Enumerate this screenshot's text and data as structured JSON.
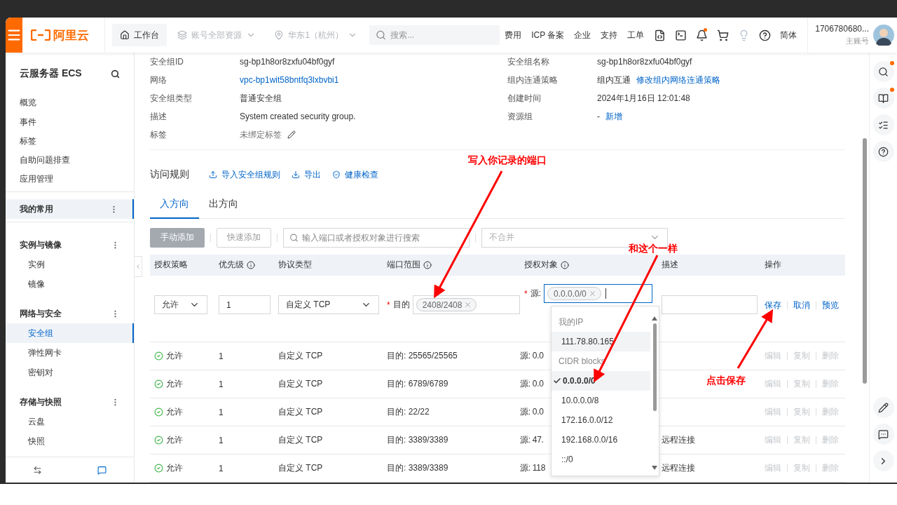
{
  "header": {
    "logo": "阿里云",
    "workbench": "工作台",
    "resources": "账号全部资源",
    "region": "华东1（杭州）",
    "search_placeholder": "搜索...",
    "links": [
      "费用",
      "ICP 备案",
      "企业",
      "支持",
      "工单"
    ],
    "icons": [
      {
        "kind": "api",
        "dot": false
      },
      {
        "kind": "terminal",
        "dot": false
      },
      {
        "kind": "bell",
        "dot": true
      },
      {
        "kind": "cart",
        "dot": false
      },
      {
        "kind": "bulb",
        "dot": false
      },
      {
        "kind": "help",
        "dot": false
      }
    ],
    "language": "简体",
    "account": {
      "id": "1706780680...",
      "role": "主账号"
    }
  },
  "sidebar": {
    "title": "云服务器 ECS",
    "items": [
      {
        "label": "概览",
        "selected": false
      },
      {
        "label": "事件",
        "selected": false
      },
      {
        "label": "标签",
        "selected": false
      },
      {
        "label": "自助问题排查",
        "selected": false
      },
      {
        "label": "应用管理",
        "selected": false
      }
    ],
    "groups": [
      {
        "label": "我的常用",
        "selected": true
      },
      {
        "label": "实例与镜像",
        "selected": false,
        "children": [
          {
            "label": "实例",
            "selected": false
          },
          {
            "label": "镜像",
            "selected": false
          }
        ]
      },
      {
        "label": "网络与安全",
        "selected": false,
        "children": [
          {
            "label": "安全组",
            "selected": true
          },
          {
            "label": "弹性网卡",
            "selected": false
          },
          {
            "label": "密钥对",
            "selected": false
          }
        ]
      },
      {
        "label": "存储与快照",
        "selected": false,
        "children": [
          {
            "label": "云盘",
            "selected": false
          },
          {
            "label": "快照",
            "selected": false
          }
        ]
      }
    ]
  },
  "details": {
    "left": [
      {
        "label": "安全组ID",
        "value": "sg-bp1h8or8zxfu04bf0gyf",
        "kind": "text"
      },
      {
        "label": "网络",
        "value": "vpc-bp1wit58bntfq3lxbvbi1",
        "kind": "link"
      },
      {
        "label": "安全组类型",
        "value": "普通安全组",
        "kind": "text"
      },
      {
        "label": "描述",
        "value": "System created security group.",
        "kind": "text"
      },
      {
        "label": "标签",
        "value": "未绑定标签",
        "kind": "tag"
      }
    ],
    "right": [
      {
        "label": "安全组名称",
        "value": "sg-bp1h8or8zxfu04bf0gyf"
      },
      {
        "label": "组内连通策略",
        "value": "组内互通",
        "link": "修改组内网络连通策略"
      },
      {
        "label": "创建时间",
        "value": "2024年1月16日 12:01:48"
      },
      {
        "label": "资源组",
        "value": "-",
        "link": "新增"
      }
    ]
  },
  "rules": {
    "title": "访问规则",
    "actions": [
      {
        "label": "导入安全组规则",
        "kind": "import"
      },
      {
        "label": "导出",
        "kind": "export"
      },
      {
        "label": "健康检查",
        "kind": "health"
      }
    ],
    "tabs": [
      {
        "label": "入方向",
        "selected": true
      },
      {
        "label": "出方向",
        "selected": false
      }
    ],
    "toolbar": {
      "buttons": [
        {
          "label": "手动添加",
          "kind": "primary",
          "disabled": true
        },
        {
          "label": "快速添加",
          "kind": "default",
          "disabled": true
        }
      ],
      "search_placeholder": "输入端口或者授权对象进行搜索",
      "merge_placeholder": "不合并"
    },
    "columns": [
      {
        "label": "授权策略",
        "info": false
      },
      {
        "label": "优先级",
        "info": true
      },
      {
        "label": "协议类型",
        "info": false
      },
      {
        "label": "端口范围",
        "info": true
      },
      {
        "label": "授权对象",
        "info": true
      },
      {
        "label": "描述",
        "info": false
      },
      {
        "label": "操作",
        "info": false
      }
    ],
    "edit_row": {
      "required_mark": "*",
      "policy": "允许",
      "priority": "1",
      "protocol": "自定义 TCP",
      "port_label": "目的",
      "port_tag": "2408/2408",
      "source_label": "源:",
      "source_tag": "0.0.0.0/0",
      "actions": [
        "保存",
        "取消",
        "预览"
      ]
    },
    "dropdown": {
      "groups": [
        {
          "label": "我的IP",
          "options": [
            {
              "label": "111.78.80.165",
              "selected": false,
              "hovered": true
            }
          ]
        },
        {
          "label": "CIDR blocks",
          "options": [
            {
              "label": "0.0.0.0/0",
              "selected": true,
              "hovered": false
            },
            {
              "label": "10.0.0.0/8",
              "selected": false,
              "hovered": false
            },
            {
              "label": "172.16.0.0/12",
              "selected": false,
              "hovered": false
            },
            {
              "label": "192.168.0.0/16",
              "selected": false,
              "hovered": false
            },
            {
              "label": "::/0",
              "selected": false,
              "hovered": false
            }
          ]
        }
      ]
    },
    "rows": [
      {
        "policy": "允许",
        "priority": "1",
        "protocol": "自定义 TCP",
        "port": "目的: 25565/25565",
        "source": "源: 0.0",
        "actions": [
          {
            "label": "编辑",
            "disabled": true
          },
          {
            "label": "复制",
            "disabled": true
          },
          {
            "label": "删除",
            "disabled": true
          }
        ]
      },
      {
        "policy": "允许",
        "priority": "1",
        "protocol": "自定义 TCP",
        "port": "目的: 6789/6789",
        "source": "源: 0.0",
        "actions": [
          {
            "label": "编辑",
            "disabled": true
          },
          {
            "label": "复制",
            "disabled": true
          },
          {
            "label": "删除",
            "disabled": true
          }
        ]
      },
      {
        "policy": "允许",
        "priority": "1",
        "protocol": "自定义 TCP",
        "port": "目的: 22/22",
        "source": "源: 0.0",
        "actions": [
          {
            "label": "编辑",
            "disabled": true
          },
          {
            "label": "复制",
            "disabled": true
          },
          {
            "label": "删除",
            "disabled": true
          }
        ]
      },
      {
        "policy": "允许",
        "priority": "1",
        "protocol": "自定义 TCP",
        "port": "目的: 3389/3389",
        "source": "源: 47.",
        "description": "远程连接",
        "actions": [
          {
            "label": "编辑",
            "disabled": true
          },
          {
            "label": "复制",
            "disabled": true
          },
          {
            "label": "删除",
            "disabled": true
          }
        ]
      },
      {
        "policy": "允许",
        "priority": "1",
        "protocol": "自定义 TCP",
        "port": "目的: 3389/3389",
        "source": "源: 118",
        "description": "远程连接",
        "actions": [
          {
            "label": "编辑",
            "disabled": true
          },
          {
            "label": "复制",
            "disabled": true
          },
          {
            "label": "删除",
            "disabled": true
          }
        ]
      }
    ]
  },
  "right_rail": [
    {
      "kind": "search",
      "dot": true
    },
    {
      "kind": "book",
      "dot": true
    },
    {
      "kind": "checklist",
      "dot": false
    },
    {
      "kind": "help",
      "dot": false
    },
    {
      "kind": "edit",
      "dot": false
    },
    {
      "kind": "feedback",
      "dot": false
    },
    {
      "kind": "expand",
      "dot": false
    }
  ],
  "annotations": [
    {
      "text": "写入你记录的端口"
    },
    {
      "text": "和这个一样"
    },
    {
      "text": "点击保存"
    }
  ]
}
